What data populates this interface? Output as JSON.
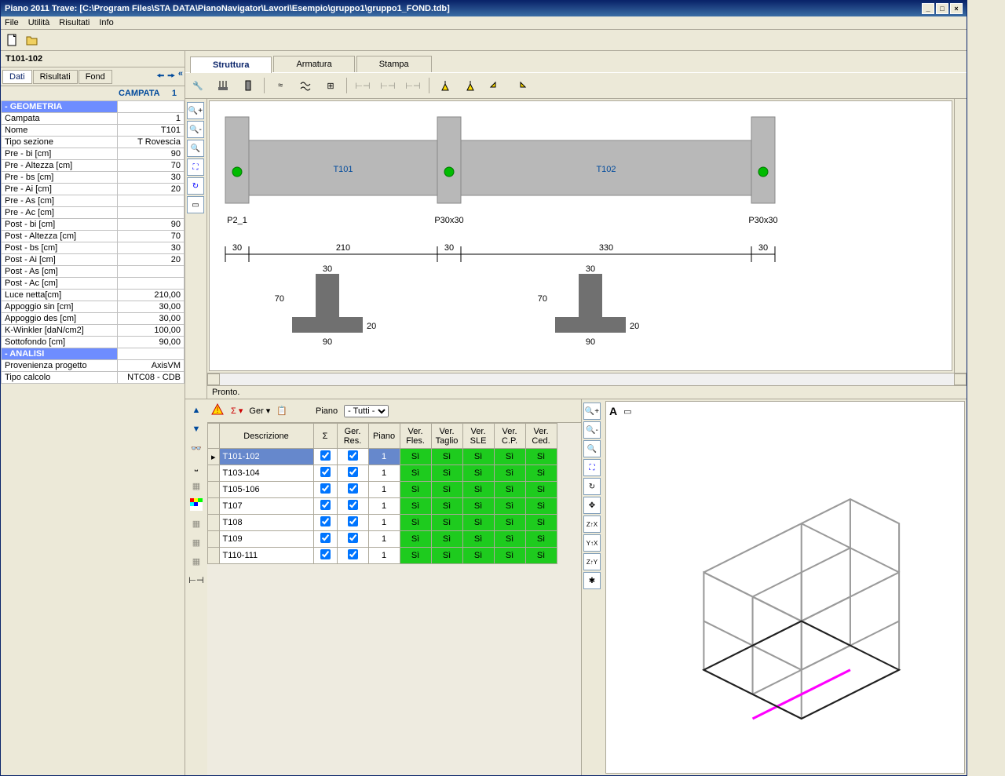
{
  "title": "Piano 2011 Trave:  [C:\\Program Files\\STA DATA\\PianoNavigator\\Lavori\\Esempio\\gruppo1\\gruppo1_FOND.tdb]",
  "menu": [
    "File",
    "Utilità",
    "Risultati",
    "Info"
  ],
  "beam_id": "T101-102",
  "left_tabs": {
    "dati": "Dati",
    "risultati": "Risultati",
    "fond": "Fond"
  },
  "campata_label": "CAMPATA",
  "campata_value": "1",
  "sections": {
    "geometria": "- GEOMETRIA",
    "analisi": "- ANALISI"
  },
  "props": [
    {
      "k": "Campata",
      "v": "1"
    },
    {
      "k": "Nome",
      "v": "T101"
    },
    {
      "k": "Tipo sezione",
      "v": "T Rovescia"
    },
    {
      "k": "Pre - bi [cm]",
      "v": "90"
    },
    {
      "k": "Pre - Altezza [cm]",
      "v": "70"
    },
    {
      "k": "Pre - bs [cm]",
      "v": "30"
    },
    {
      "k": "Pre - Ai [cm]",
      "v": "20"
    },
    {
      "k": "Pre - As [cm]",
      "v": ""
    },
    {
      "k": "Pre - Ac [cm]",
      "v": ""
    },
    {
      "k": "Post - bi [cm]",
      "v": "90"
    },
    {
      "k": "Post - Altezza [cm]",
      "v": "70"
    },
    {
      "k": "Post - bs [cm]",
      "v": "30"
    },
    {
      "k": "Post - Ai [cm]",
      "v": "20"
    },
    {
      "k": "Post - As [cm]",
      "v": ""
    },
    {
      "k": "Post - Ac [cm]",
      "v": ""
    },
    {
      "k": "Luce netta[cm]",
      "v": "210,00"
    },
    {
      "k": "Appoggio sin [cm]",
      "v": "30,00"
    },
    {
      "k": "Appoggio des [cm]",
      "v": "30,00"
    },
    {
      "k": "K-Winkler [daN/cm2]",
      "v": "100,00"
    },
    {
      "k": "Sottofondo [cm]",
      "v": "90,00"
    }
  ],
  "analisi_props": [
    {
      "k": "Provenienza progetto",
      "v": "AxisVM"
    },
    {
      "k": "Tipo calcolo",
      "v": "NTC08 - CDB"
    }
  ],
  "main_tabs": {
    "struttura": "Struttura",
    "armatura": "Armatura",
    "stampa": "Stampa"
  },
  "drawing": {
    "beam_labels": [
      "T101",
      "T102"
    ],
    "col_labels": [
      "P2_1",
      "P30x30",
      "P30x30"
    ],
    "dims_top": [
      "30",
      "210",
      "30",
      "330",
      "30"
    ],
    "section_dims": {
      "bs": "30",
      "h": "70",
      "bi": "90",
      "ai": "20"
    }
  },
  "status": "Pronto.",
  "filter": {
    "piano_label": "Piano",
    "piano_value": "- Tutti -"
  },
  "grid_headers": [
    "Descrizione",
    "Σ",
    "Ger. Res.",
    "Piano",
    "Ver. Fles.",
    "Ver. Taglio",
    "Ver. SLE",
    "Ver. C.P.",
    "Ver. Ced."
  ],
  "grid_rows": [
    {
      "desc": "T101-102",
      "sum": true,
      "ger": true,
      "piano": "1",
      "sel": true
    },
    {
      "desc": "T103-104",
      "sum": true,
      "ger": true,
      "piano": "1"
    },
    {
      "desc": "T105-106",
      "sum": true,
      "ger": true,
      "piano": "1"
    },
    {
      "desc": "T107",
      "sum": true,
      "ger": true,
      "piano": "1"
    },
    {
      "desc": "T108",
      "sum": true,
      "ger": true,
      "piano": "1"
    },
    {
      "desc": "T109",
      "sum": true,
      "ger": true,
      "piano": "1"
    },
    {
      "desc": "T110-111",
      "sum": true,
      "ger": true,
      "piano": "1"
    }
  ],
  "si_text": "Sì",
  "br_header_a": "A"
}
